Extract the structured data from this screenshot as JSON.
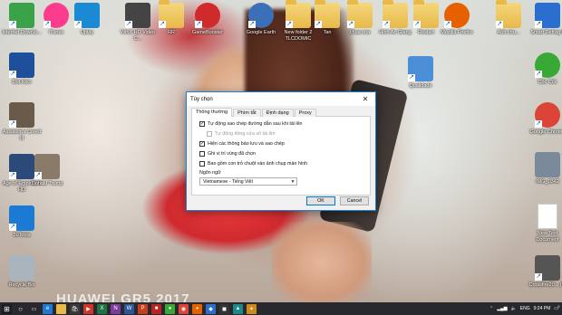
{
  "wallpaper": {
    "watermark": "HUAWEI GR5 2017"
  },
  "desktop_icons": [
    {
      "label": "Internet Downlo...",
      "icon": "idm-icon",
      "color": "#3aa34a"
    },
    {
      "label": "iTunes",
      "icon": "itunes-icon",
      "color": "#fc3c8d"
    },
    {
      "label": "Uplay",
      "icon": "uplay-icon",
      "color": "#1a8ad4"
    },
    {
      "label": "WinX HD Video C...",
      "icon": "winx-icon",
      "color": "#444"
    },
    {
      "label": "RR",
      "icon": "folder-icon",
      "color": "#e8b949"
    },
    {
      "label": "GameBooster",
      "icon": "gamebooster-icon",
      "color": "#d02a2a"
    },
    {
      "label": "Google Earth",
      "icon": "google-earth-icon",
      "color": "#3b6fb8"
    },
    {
      "label": "New folder 2 TLCDOMIC",
      "icon": "folder-icon",
      "color": "#e8b949"
    },
    {
      "label": "Tan",
      "icon": "folder-icon",
      "color": "#e8b949"
    },
    {
      "label": "chua xoa",
      "icon": "folder-icon",
      "color": "#e8b949"
    },
    {
      "label": "Hinh An Giang",
      "icon": "folder-icon",
      "color": "#e8b949"
    },
    {
      "label": "Restart",
      "icon": "folder-icon",
      "color": "#e8b949"
    },
    {
      "label": "Mozilla Firefox",
      "icon": "firefox-icon",
      "color": "#e66000"
    },
    {
      "label": "Anh chu...",
      "icon": "folder-icon",
      "color": "#e8b949"
    },
    {
      "label": "Smart Defrag 5",
      "icon": "smart-defrag-icon",
      "color": "#2a6fd0"
    },
    {
      "label": "Dot Kich",
      "icon": "dot-kich-icon",
      "color": "#1e4f9a"
    },
    {
      "label": "Assassin's Creed III",
      "icon": "assassins-creed-icon",
      "color": "#6a5a4a"
    },
    {
      "label": "Age of Empires II HD",
      "icon": "aoe-icon",
      "color": "#2b4a7a"
    },
    {
      "label": "Donald Trump",
      "icon": "photo-icon",
      "color": "#8a7a6a"
    },
    {
      "label": "3uTools",
      "icon": "3utools-icon",
      "color": "#1a7ad4"
    },
    {
      "label": "Recycle Bin",
      "icon": "recycle-bin-icon",
      "color": "#aab4bc"
    },
    {
      "label": "Cốc Cốc",
      "icon": "coccoc-icon",
      "color": "#39a935"
    },
    {
      "label": "Google Chrome",
      "icon": "chrome-icon",
      "color": "#db4437"
    },
    {
      "label": "IMG_0342",
      "icon": "image-file-icon",
      "color": "#7b8a9a"
    },
    {
      "label": "New Text Document",
      "icon": "text-file-icon",
      "color": "#ffffff"
    },
    {
      "label": "Crossfire20... (2)",
      "icon": "crossfire-icon",
      "color": "#555"
    },
    {
      "label": "Qualidade",
      "icon": "qualidade-icon",
      "color": "#4a8fd8"
    }
  ],
  "dialog": {
    "title": "Tùy chọn",
    "tabs": [
      "Thông thường",
      "Phím tắt",
      "Định dạng",
      "Proxy"
    ],
    "options": [
      {
        "label": "Tự động sao chép đường dẫn sau khi tải lên",
        "checked": true,
        "disabled": false,
        "indent": false
      },
      {
        "label": "Tự động đóng cửa sổ tải lên",
        "checked": false,
        "disabled": true,
        "indent": true
      },
      {
        "label": "Hiện các thông báo lưu và sao chép",
        "checked": true,
        "disabled": false,
        "indent": false
      },
      {
        "label": "Ghi vị trí vùng đã chọn",
        "checked": false,
        "disabled": false,
        "indent": false
      },
      {
        "label": "Bao gồm con trỏ chuột vào ảnh chụp màn hình",
        "checked": false,
        "disabled": false,
        "indent": false
      }
    ],
    "language_label": "Ngôn ngữ",
    "language_value": "Vietnamese - Tiếng Việt",
    "ok_label": "OK",
    "cancel_label": "Cancel"
  },
  "taskbar": {
    "language": "ENG",
    "time": "9:24 PM",
    "date": "",
    "notification_count": "2"
  }
}
